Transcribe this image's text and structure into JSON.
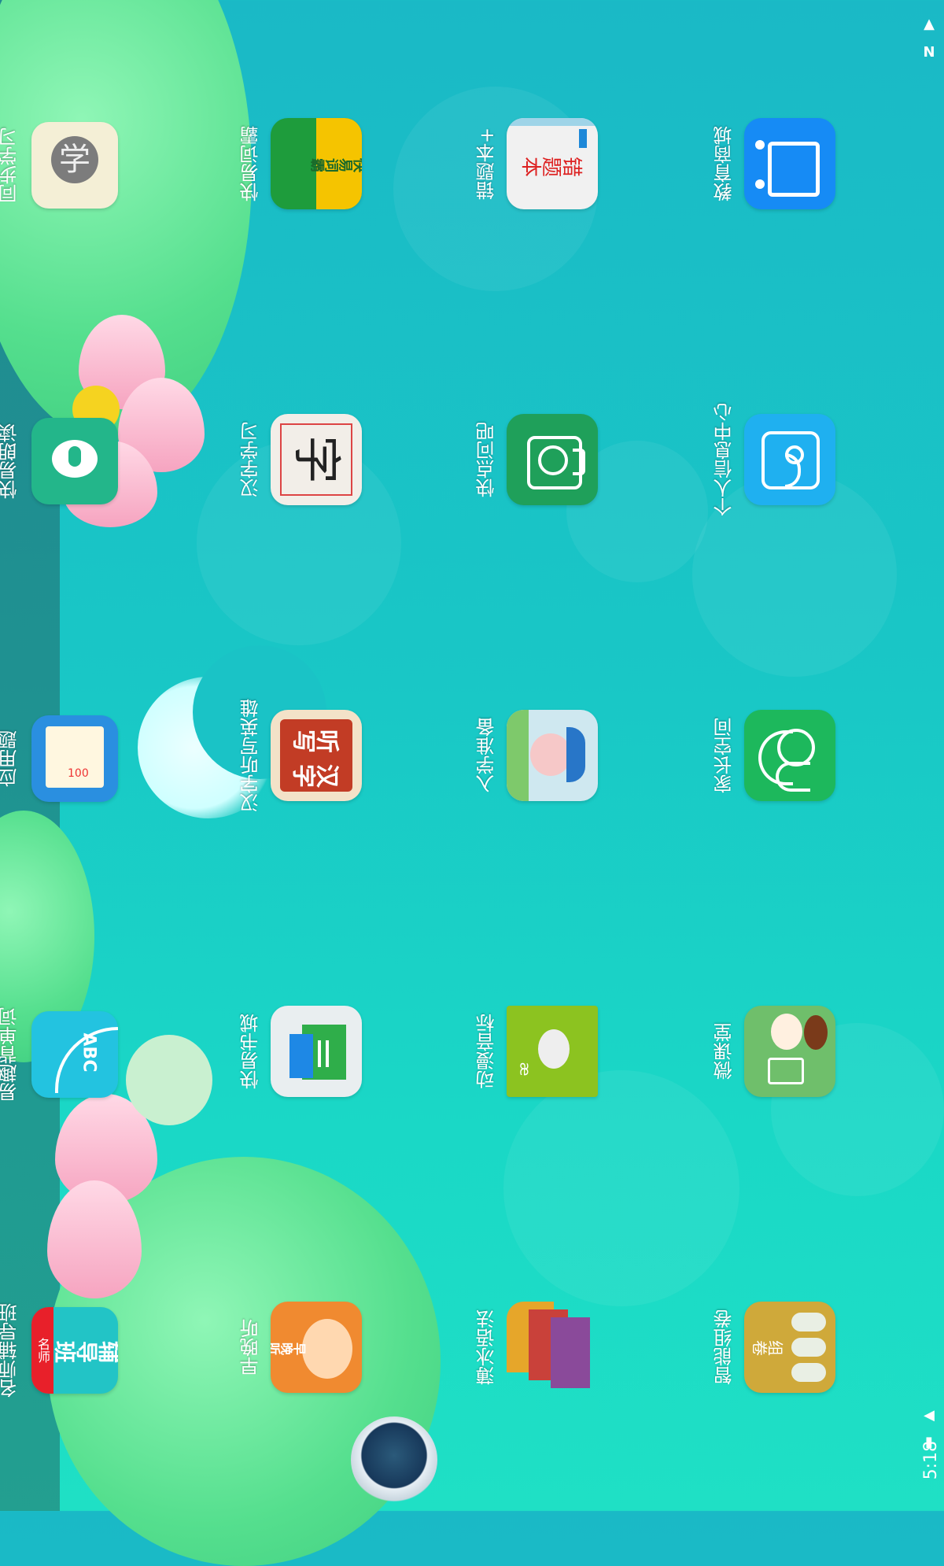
{
  "status_bar": {
    "time": "5:18",
    "icons": [
      "notification-icon",
      "n-icon",
      "wifi-icon",
      "battery-icon"
    ]
  },
  "apps": {
    "col1": [
      {
        "name": "同步学习",
        "color": "#f4efd6",
        "icon": "sync-study-icon"
      },
      {
        "name": "快易朗读",
        "color": "#23b68a",
        "icon": "microphone-icon"
      },
      {
        "name": "应用题",
        "color": "#2a8fe0",
        "icon": "word-problem-icon"
      },
      {
        "name": "易趣背单词",
        "color": "#23c3e0",
        "icon": "abc-icon"
      },
      {
        "name": "名师辅导班",
        "color": "#22c4c6",
        "icon": "tutor-class-icon"
      }
    ],
    "col2": [
      {
        "name": "快易词霸",
        "color": "#f5c400",
        "icon": "dictionary-icon"
      },
      {
        "name": "汉字学习",
        "color": "#f2eee8",
        "icon": "hanzi-icon"
      },
      {
        "name": "汉字听写英雄",
        "color": "#e8d6b8",
        "icon": "dictation-icon"
      },
      {
        "name": "快易书城",
        "color": "#e9eef0",
        "icon": "bookstore-icon"
      },
      {
        "name": "早晚听",
        "color": "#f08a30",
        "icon": "listen-icon"
      }
    ],
    "col3": [
      {
        "name": "错题本+",
        "color": "#f1f1f1",
        "icon": "error-book-icon"
      },
      {
        "name": "快点问吧",
        "color": "#1fa05a",
        "icon": "camera-icon"
      },
      {
        "name": "入学准备",
        "color": "#7ec96b",
        "icon": "school-prep-icon"
      },
      {
        "name": "动漫音标",
        "color": "#8cc320",
        "icon": "phonetics-icon"
      },
      {
        "name": "薄冰语法",
        "color": "#c9413a",
        "icon": "grammar-icon"
      }
    ],
    "col4": [
      {
        "name": "教育商城",
        "color": "#168bf5",
        "icon": "shopping-icon"
      },
      {
        "name": "个人信息中心",
        "color": "#1fb0f0",
        "icon": "user-info-icon"
      },
      {
        "name": "家长空间",
        "color": "#1db85c",
        "icon": "parents-icon"
      },
      {
        "name": "微课堂",
        "color": "#6fbf6b",
        "icon": "micro-class-icon"
      },
      {
        "name": "智能组卷",
        "color": "#cfa93a",
        "icon": "exam-paper-icon"
      }
    ]
  },
  "glyphs": {
    "error_book": "错题本",
    "dictionary": "快易词霸",
    "hanzi": "字",
    "dictation": "汉字听写",
    "listen": "早晚听",
    "tutor": "辅导班",
    "famous": "名师",
    "sync": "学",
    "abc": "ABC",
    "score": "100",
    "phonetic": "æ",
    "compose": "组卷"
  }
}
